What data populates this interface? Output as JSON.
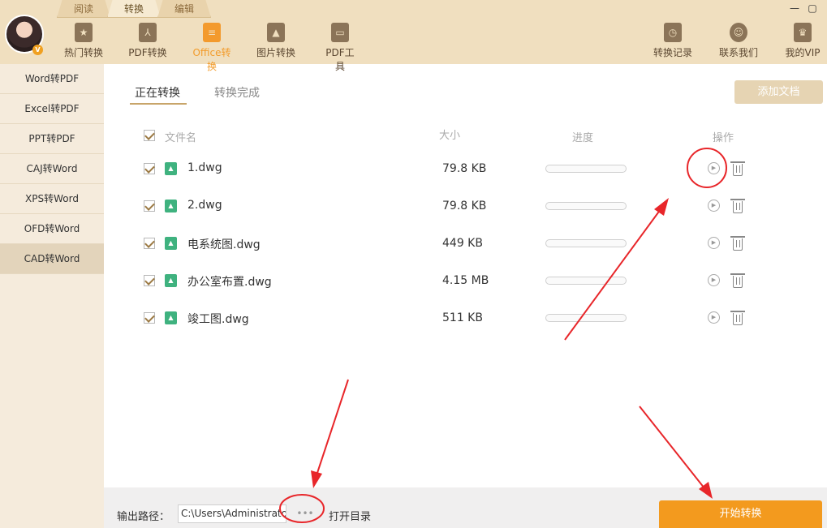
{
  "top_tabs": [
    "阅读",
    "转换",
    "编辑"
  ],
  "active_top_tab": 1,
  "nav": [
    {
      "label": "热门转换",
      "icon": "star-icon"
    },
    {
      "label": "PDF转换",
      "icon": "pdf-icon"
    },
    {
      "label": "Office转换",
      "icon": "office-icon"
    },
    {
      "label": "图片转换",
      "icon": "image-icon"
    },
    {
      "label": "PDF工具",
      "icon": "toolbox-icon"
    }
  ],
  "right_nav": [
    {
      "label": "转换记录",
      "icon": "history-icon"
    },
    {
      "label": "联系我们",
      "icon": "headset-icon"
    },
    {
      "label": "我的VIP",
      "icon": "crown-icon"
    }
  ],
  "vip_badge": "V",
  "sidebar": [
    "Word转PDF",
    "Excel转PDF",
    "PPT转PDF",
    "CAJ转Word",
    "XPS转Word",
    "OFD转Word",
    "CAD转Word"
  ],
  "sidebar_active": 6,
  "sub_tabs": {
    "converting": "正在转换",
    "done": "转换完成"
  },
  "add_button": "添加文档",
  "columns": {
    "name": "文件名",
    "size": "大小",
    "progress": "进度",
    "action": "操作"
  },
  "files": [
    {
      "name": "1.dwg",
      "size": "79.8 KB",
      "progress": 0
    },
    {
      "name": "2.dwg",
      "size": "79.8 KB",
      "progress": 0
    },
    {
      "name": "电系统图.dwg",
      "size": "449 KB",
      "progress": 0
    },
    {
      "name": "办公室布置.dwg",
      "size": "4.15 MB",
      "progress": 0
    },
    {
      "name": "竣工图.dwg",
      "size": "511 KB",
      "progress": 0
    }
  ],
  "output": {
    "label": "输出路径：",
    "path": "C:\\Users\\Administrator",
    "more": "•••",
    "open_dir": "打开目录"
  },
  "start_button": "开始转换",
  "colors": {
    "accent": "#f39a1e",
    "header_bg": "#f0dfbf",
    "annotation": "#e8262a"
  }
}
